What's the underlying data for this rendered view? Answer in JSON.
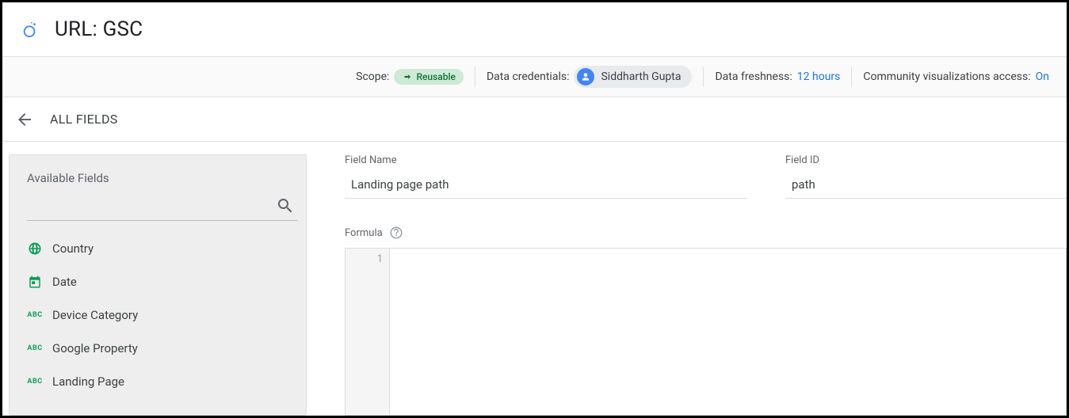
{
  "header": {
    "title": "URL: GSC"
  },
  "statusbar": {
    "scope_label": "Scope:",
    "scope_chip": "Reusable",
    "creds_label": "Data credentials:",
    "creds_user": "Siddharth Gupta",
    "freshness_label": "Data freshness:",
    "freshness_value": "12 hours",
    "viz_label": "Community visualizations access:",
    "viz_value": "On"
  },
  "nav": {
    "back_label": "ALL FIELDS"
  },
  "leftpanel": {
    "title": "Available Fields",
    "search_placeholder": "",
    "fields": [
      {
        "icon": "globe",
        "label": "Country"
      },
      {
        "icon": "calendar",
        "label": "Date"
      },
      {
        "icon": "abc",
        "label": "Device Category"
      },
      {
        "icon": "abc",
        "label": "Google Property"
      },
      {
        "icon": "abc",
        "label": "Landing Page"
      }
    ]
  },
  "rightpanel": {
    "field_name_label": "Field Name",
    "field_name_value": "Landing page path",
    "field_id_label": "Field ID",
    "field_id_value": "path",
    "formula_label": "Formula",
    "gutter_line": "1"
  }
}
